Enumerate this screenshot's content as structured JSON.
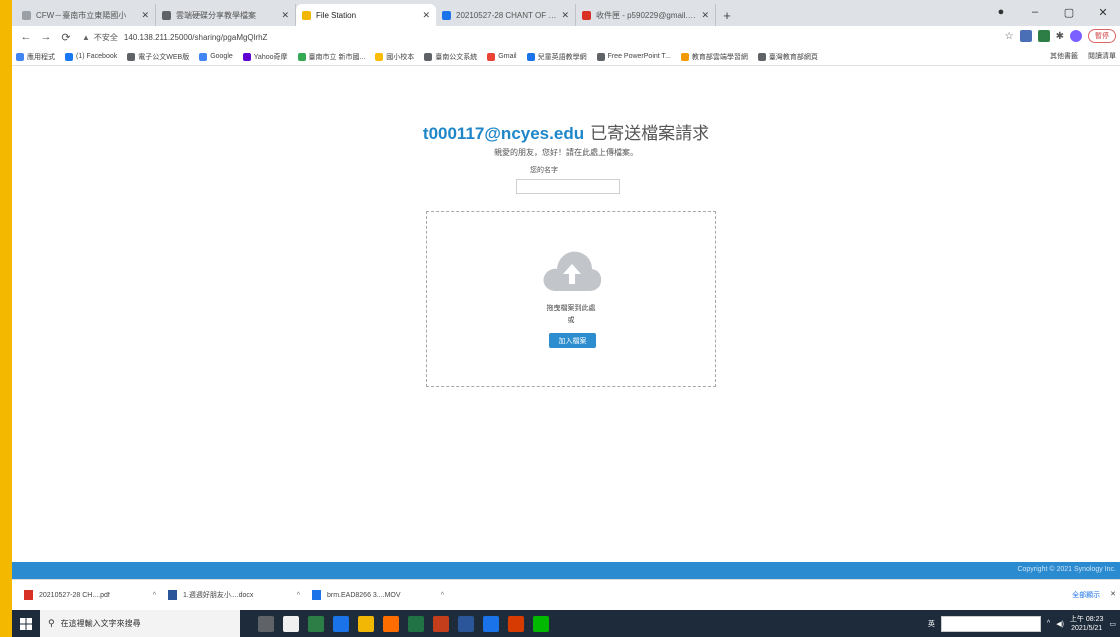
{
  "browser": {
    "tabs": [
      {
        "label": "CFW－臺南市立東陽國小",
        "color": "#9aa0a6",
        "active": false
      },
      {
        "label": "雲端硬碟分享教學檔案",
        "color": "#5f6368",
        "active": false
      },
      {
        "label": "File Station",
        "color": "#f2b705",
        "active": true
      },
      {
        "label": "20210527-28 CHANT OF CHA",
        "color": "#1a73e8",
        "active": false
      },
      {
        "label": "收件匣 - p590229@gmail.com",
        "color": "#d93025",
        "active": false
      }
    ],
    "new_tab": "+",
    "window_controls": {
      "minimize": "–",
      "maximize": "▢",
      "close": "✕"
    },
    "address": {
      "security": "不安全",
      "url": "140.138.211.25000/sharing/pgaMgQlrhZ"
    },
    "profile_label": "暫停",
    "bookmarks": [
      {
        "label": "應用程式",
        "color": "#4285f4"
      },
      {
        "label": "(1) Facebook",
        "color": "#1877f2"
      },
      {
        "label": "電子公文WEB版",
        "color": "#5f6368"
      },
      {
        "label": "Google",
        "color": "#4285f4"
      },
      {
        "label": "Yahoo奇摩",
        "color": "#6001d2"
      },
      {
        "label": "臺南市立 新市國...",
        "color": "#34a853"
      },
      {
        "label": "國小校本",
        "color": "#fbbc04"
      },
      {
        "label": "臺南公文系統",
        "color": "#5f6368"
      },
      {
        "label": "Gmail",
        "color": "#ea4335"
      },
      {
        "label": "兒童英語教學網",
        "color": "#1a73e8"
      },
      {
        "label": "Free PowerPoint T...",
        "color": "#5f6368"
      },
      {
        "label": "教育部雲端學習網",
        "color": "#f29900"
      },
      {
        "label": "臺灣教育部網頁",
        "color": "#5f6368"
      }
    ],
    "bookmarks_right": [
      "其他書籤",
      "閱讀清單"
    ]
  },
  "page": {
    "email": "t000117@ncyes.edu",
    "request_text": "已寄送檔案請求",
    "subtitle": "親愛的朋友，您好！請在此處上傳檔案。",
    "name_label": "您的名字",
    "name_value": "",
    "drop_text": "拖曳檔案到此處",
    "or_text": "或",
    "upload_button": "加入檔案",
    "copyright": "Copyright © 2021 Synology Inc."
  },
  "downloads": {
    "items": [
      {
        "label": "20210527-28 CH....pdf",
        "color": "#d93025"
      },
      {
        "label": "1.週週好朋友小....docx",
        "color": "#2b579a"
      },
      {
        "label": "brm.EAD8266 3....MOV",
        "color": "#1a73e8"
      }
    ],
    "show_all": "全部顯示",
    "close": "✕"
  },
  "taskbar": {
    "search_placeholder": "在這裡輸入文字來搜尋",
    "apps": [
      "#5f6368",
      "#f0f0f0",
      "#2d7d46",
      "#1a73e8",
      "#f2b705",
      "#ff6d00",
      "#217346",
      "#c43e1c",
      "#2b579a",
      "#1a73e8",
      "#d83b01",
      "#00b900"
    ],
    "lang": "英",
    "time": "上午 08:23",
    "date": "2021/5/21"
  }
}
